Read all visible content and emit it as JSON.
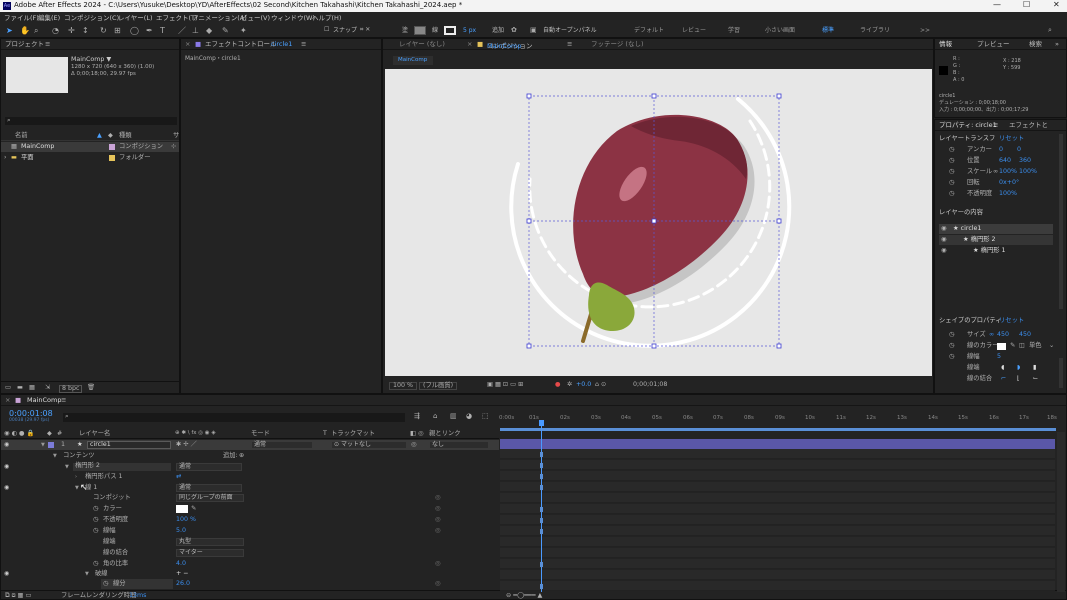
{
  "app": {
    "title": "Adobe After Effects 2024 - C:\\Users\\Yusuke\\Desktop\\YD\\AfterEffects\\02 Second\\Kitchen Takahashi\\Kitchen Takahashi_2024.aep *",
    "logo": "Ae"
  },
  "menu": [
    "ファイル(F)",
    "編集(E)",
    "コンポジション(C)",
    "レイヤー(L)",
    "エフェクト(T)",
    "アニメーション(A)",
    "ビュー(V)",
    "ウィンドウ(W)",
    "ヘルプ(H)"
  ],
  "toolbar": {
    "snap": "スナップ",
    "fill": "塗",
    "stroke": "線",
    "px": "5 px",
    "add": "追加",
    "auto_open": "自動オープンパネル",
    "workspaces": [
      "デフォルト",
      "レビュー",
      "学習",
      "小さい画面",
      "標準",
      "ライブラリ"
    ],
    "more": ">>"
  },
  "project": {
    "title": "プロジェクト",
    "menu": "≡",
    "item_name": "MainComp ▼",
    "item_size": "1280 x 720 (640 x 360) (1.00)",
    "item_duration": "Δ 0;00;18;00, 29.97 fps",
    "search_icon": "search-icon",
    "col_name": "名前",
    "col_type": "種類",
    "col_extra": "サ",
    "rows": [
      {
        "name": "MainComp",
        "type": "コンポジション",
        "color": "#c9a3d6"
      },
      {
        "name": "平面",
        "type": "フォルダー",
        "color": "#e5c35a"
      }
    ],
    "bpc": "8 bpc"
  },
  "effect_controls": {
    "title": "エフェクトコントロール",
    "layer": "circle1",
    "subtitle": "MainComp・circle1"
  },
  "viewer": {
    "tab_layer": "レイヤー (なし)",
    "tab_comp": "コンポジション",
    "comp_name": "MainComp",
    "tab_footage": "フッテージ (なし)",
    "comp_chip": "MainComp",
    "zoom": "100 %",
    "quality": "(フル画質)",
    "exposure": "+0.0",
    "timecode": "0;00;01;08"
  },
  "info": {
    "tab_info": "情報",
    "tab_preview": "プレビュー",
    "tab_search": "検索",
    "r": "R :",
    "g": "G :",
    "b": "B :",
    "a": "A : 0",
    "x": "X : 218",
    "y": "Y : 599",
    "layer": "circle1",
    "duration": "デュレーション : 0;00;18;00",
    "inout": "入力 : 0;00;00;00、出力 : 0;00;17;29"
  },
  "properties": {
    "tab": "プロパティ: circle1",
    "tab2": "エフェクトと",
    "section_transform": "レイヤートランスフ",
    "reset": "リセット",
    "anchor": "アンカー",
    "anchor_v1": "0",
    "anchor_v2": "0",
    "position": "位置",
    "pos_x": "640",
    "pos_y": "360",
    "scale": "スケール",
    "scale_x": "100%",
    "scale_y": "100%",
    "rotation": "回転",
    "rotation_v": "0x+0°",
    "opacity": "不透明度",
    "opacity_v": "100%",
    "section_contents": "レイヤーの内容",
    "contents": [
      "circle1",
      "楕円形 2",
      "楕円形 1"
    ],
    "section_shape": "シェイプのプロパティ",
    "shape_reset": "リセット",
    "size": "サイズ",
    "size_w": "450",
    "size_h": "450",
    "stroke_color": "線のカラー",
    "stroke_mode": "単色",
    "stroke_width": "線幅",
    "stroke_width_v": "5",
    "cap": "線端",
    "join": "線の結合"
  },
  "timeline": {
    "tab": "MainComp",
    "timecode": "0:00:01:08",
    "frame": "00038 (29.97 fps)",
    "col_layer": "レイヤー名",
    "col_switches": "⊕ ✱ \\ fx ◎ ◉ ◈",
    "col_mode": "モード",
    "col_t": "T",
    "col_track": "トラックマット",
    "col_parent": "親とリンク",
    "layer_num": "1",
    "layer_name": "circle1",
    "mode": "通常",
    "track": "マットなし",
    "parent": "なし",
    "contents": "コンテンツ",
    "add": "追加:",
    "ellipse": "楕円形 2",
    "ellipse_mode": "通常",
    "ellipse_path": "楕円形パス 1",
    "stroke": "線 1",
    "stroke_mode": "通常",
    "composite": "コンポジット",
    "composite_v": "同じグループの前面",
    "color": "カラー",
    "opacity": "不透明度",
    "opacity_v": "100 %",
    "width": "線幅",
    "width_v": "5.0",
    "cap": "線端",
    "cap_v": "丸型",
    "join": "線の結合",
    "join_v": "マイター",
    "miter": "角の比率",
    "miter_v": "4.0",
    "dashes": "破線",
    "dash": "線分",
    "dash_v": "26.0",
    "plus": "+ −",
    "render": "フレームレンダリング時間",
    "render_v": "13ms",
    "ruler": [
      "0:00s",
      "01s",
      "02s",
      "03s",
      "04s",
      "05s",
      "06s",
      "07s",
      "08s",
      "09s",
      "10s",
      "11s",
      "12s",
      "13s",
      "14s",
      "15s",
      "16s",
      "17s",
      "18s"
    ]
  },
  "colors": {
    "accent": "#2d8ceb",
    "playhead": "#4a9aff",
    "plum": "#8c3344",
    "leaf": "#8aa83a",
    "layer_bar": "#5a57a8"
  }
}
